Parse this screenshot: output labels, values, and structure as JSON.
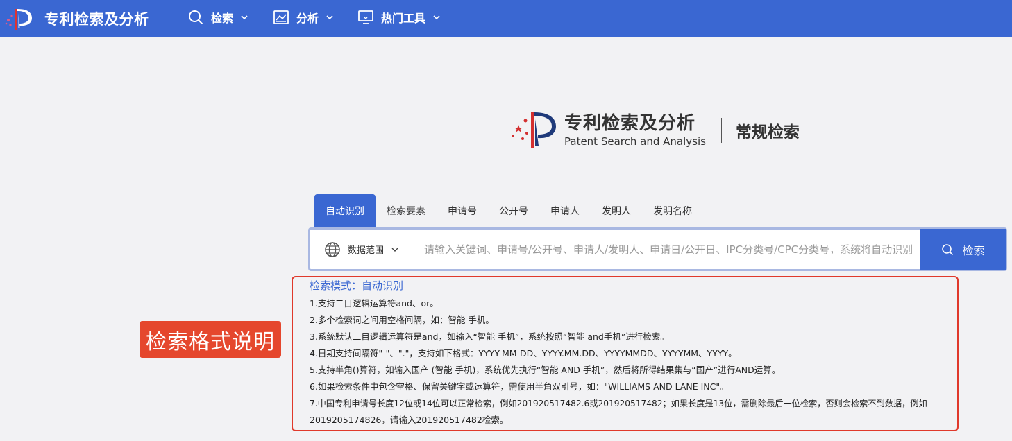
{
  "topbar": {
    "app_title": "专利检索及分析",
    "nav": [
      {
        "label": "检索"
      },
      {
        "label": "分析"
      },
      {
        "label": "热门工具"
      }
    ]
  },
  "hero": {
    "title_cn": "专利检索及分析",
    "title_en": "Patent Search and Analysis",
    "mode": "常规检索"
  },
  "tabs": [
    {
      "label": "自动识别",
      "active": true
    },
    {
      "label": "检索要素"
    },
    {
      "label": "申请号"
    },
    {
      "label": "公开号"
    },
    {
      "label": "申请人"
    },
    {
      "label": "发明人"
    },
    {
      "label": "发明名称"
    }
  ],
  "search": {
    "scope_label": "数据范围",
    "placeholder": "请输入关键词、申请号/公开号、申请人/发明人、申请日/公开日、IPC分类号/CPC分类号，系统将自动识别",
    "button_label": "检索"
  },
  "help": {
    "mode_line": "检索模式：自动识别",
    "lines": [
      "1.支持二目逻辑运算符and、or。",
      "2.多个检索词之间用空格间隔，如：智能 手机。",
      "3.系统默认二目逻辑运算符是and，如输入“智能 手机”，系统按照“智能 and手机”进行检索。",
      "4.日期支持间隔符\"-\"、\".\"，支持如下格式：YYYY-MM-DD、YYYY.MM.DD、YYYYMMDD、YYYYMM、YYYY。",
      "5.支持半角()算符，如输入国产 (智能 手机)，系统优先执行“智能 AND 手机”，然后将所得结果集与“国产”进行AND运算。",
      "6.如果检索条件中包含空格、保留关键字或运算符，需使用半角双引号，如：\"WILLIAMS AND LANE INC\"。",
      "7.中国专利申请号长度12位或14位可以正常检索，例如201920517482.6或201920517482；如果长度是13位，需删除最后一位检索，否则会检索不到数据，例如",
      "2019205174826，请输入201920517482检索。"
    ]
  },
  "annotation_label": "检索格式说明",
  "colors": {
    "brand_blue": "#3a67d2",
    "annotation_red": "#e5472d",
    "border_red": "#e0392b"
  }
}
